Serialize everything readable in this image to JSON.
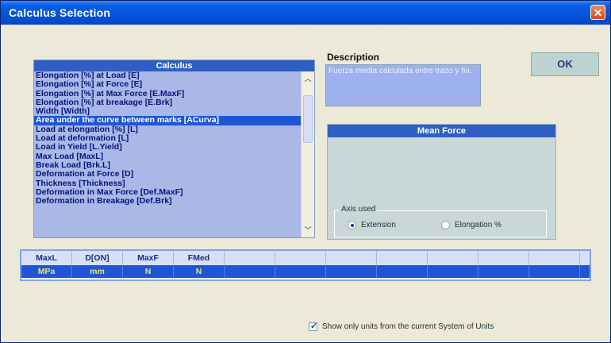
{
  "window": {
    "title": "Calculus Selection",
    "close_glyph": "✕"
  },
  "calculus": {
    "header": "Calculus",
    "selected_index": 5,
    "items": [
      "Elongation [%] at Load [E]",
      "Elongation [%] at Force [E]",
      "Elongation [%] at Max Force [E.MaxF]",
      "Elongation [%] at breakage [E.Brk]",
      "Width [Width]",
      "Area under the curve between marks [ACurva]",
      "Load at elongation [%] [L]",
      "Load at deformation [L]",
      "Load in Yield [L.Yield]",
      "Max Load [MaxL]",
      "Break Load [Brk.L]",
      "Deformation at Force [D]",
      "Thickness [Thickness]",
      "Deformation in Max Force [Def.MaxF]",
      "Deformation in Breakage [Def.Brk]"
    ]
  },
  "description": {
    "label": "Description",
    "text": "Fuerza media calculada entre trazo y fin."
  },
  "ok_button": {
    "label": "OK"
  },
  "mean_force": {
    "header": "Mean Force",
    "axis_used": {
      "legend": "Axis used",
      "options": [
        {
          "label": "Extension",
          "selected": true
        },
        {
          "label": "Elongation %",
          "selected": false
        }
      ]
    }
  },
  "units_table": {
    "headers": [
      "MaxL",
      "D[ON]",
      "MaxF",
      "FMed",
      "",
      "",
      "",
      "",
      "",
      "",
      ""
    ],
    "values": [
      "MPa",
      "mm",
      "N",
      "N",
      "",
      "",
      "",
      "",
      "",
      "",
      ""
    ]
  },
  "show_units": {
    "label": "Show only units from the current System of Units",
    "checked": true
  }
}
